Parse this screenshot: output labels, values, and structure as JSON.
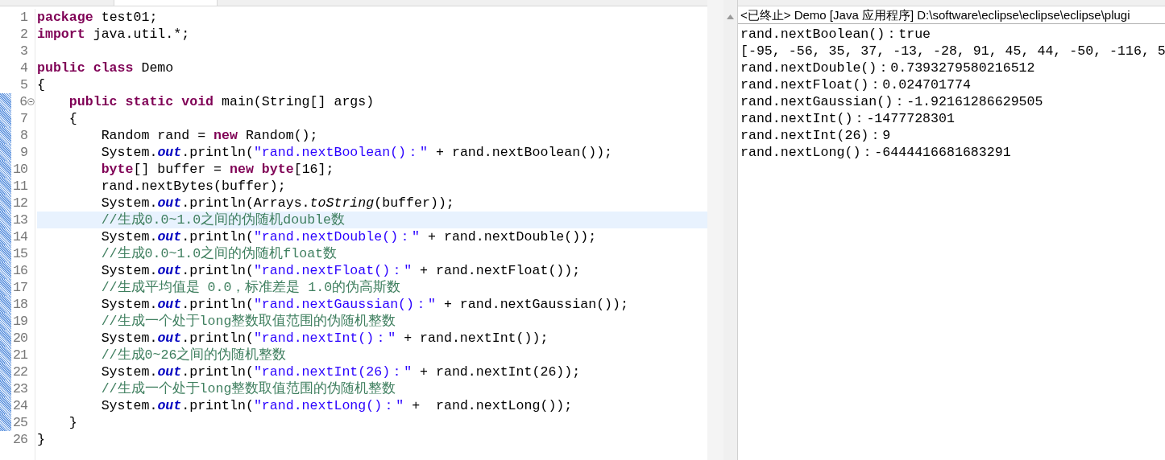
{
  "editor": {
    "lines": [
      {
        "number": "1",
        "changed": false,
        "current": false,
        "foldable": false,
        "tokens": [
          {
            "kind": "keyword",
            "text": "package"
          },
          {
            "kind": "plain",
            "text": " test01;"
          }
        ]
      },
      {
        "number": "2",
        "changed": false,
        "current": false,
        "foldable": false,
        "tokens": [
          {
            "kind": "keyword",
            "text": "import"
          },
          {
            "kind": "plain",
            "text": " java.util.*;"
          }
        ]
      },
      {
        "number": "3",
        "changed": false,
        "current": false,
        "foldable": false
      },
      {
        "number": "4",
        "changed": false,
        "current": false,
        "foldable": false,
        "tokens": [
          {
            "kind": "keyword",
            "text": "public class"
          },
          {
            "kind": "plain",
            "text": " Demo"
          }
        ]
      },
      {
        "number": "5",
        "changed": false,
        "current": false,
        "foldable": false,
        "tokens": [
          {
            "kind": "plain",
            "text": "{"
          }
        ]
      },
      {
        "number": "6",
        "changed": true,
        "current": false,
        "foldable": true,
        "tokens": [
          {
            "kind": "keyword",
            "text": "    public static void"
          },
          {
            "kind": "plain",
            "text": " main(String[] args)"
          }
        ]
      },
      {
        "number": "7",
        "changed": true,
        "current": false,
        "foldable": false,
        "tokens": [
          {
            "kind": "plain",
            "text": "    {"
          }
        ]
      },
      {
        "number": "8",
        "changed": true,
        "current": false,
        "foldable": false,
        "tokens": [
          {
            "kind": "plain",
            "text": "        Random rand = "
          },
          {
            "kind": "keyword",
            "text": "new"
          },
          {
            "kind": "plain",
            "text": " Random();"
          }
        ]
      },
      {
        "number": "9",
        "changed": true,
        "current": false,
        "foldable": false,
        "tokens": [
          {
            "kind": "plain",
            "text": "        System."
          },
          {
            "kind": "field",
            "text": "out"
          },
          {
            "kind": "plain",
            "text": ".println("
          },
          {
            "kind": "string",
            "text": "\"rand.nextBoolean()：\""
          },
          {
            "kind": "plain",
            "text": " + rand.nextBoolean());"
          }
        ]
      },
      {
        "number": "10",
        "changed": true,
        "current": false,
        "foldable": false,
        "tokens": [
          {
            "kind": "keyword",
            "text": "        byte"
          },
          {
            "kind": "plain",
            "text": "[] buffer = "
          },
          {
            "kind": "keyword",
            "text": "new byte"
          },
          {
            "kind": "plain",
            "text": "[16];"
          }
        ]
      },
      {
        "number": "11",
        "changed": true,
        "current": false,
        "foldable": false,
        "tokens": [
          {
            "kind": "plain",
            "text": "        rand.nextBytes(buffer);"
          }
        ]
      },
      {
        "number": "12",
        "changed": true,
        "current": false,
        "foldable": false,
        "tokens": [
          {
            "kind": "plain",
            "text": "        System."
          },
          {
            "kind": "field",
            "text": "out"
          },
          {
            "kind": "plain",
            "text": ".println(Arrays."
          },
          {
            "kind": "static",
            "text": "toString"
          },
          {
            "kind": "plain",
            "text": "(buffer));"
          }
        ]
      },
      {
        "number": "13",
        "changed": true,
        "current": true,
        "foldable": false,
        "tokens": [
          {
            "kind": "comment",
            "text": "        //生成0.0~1.0之间的伪随机double数"
          }
        ]
      },
      {
        "number": "14",
        "changed": true,
        "current": false,
        "foldable": false,
        "tokens": [
          {
            "kind": "plain",
            "text": "        System."
          },
          {
            "kind": "field",
            "text": "out"
          },
          {
            "kind": "plain",
            "text": ".println("
          },
          {
            "kind": "string",
            "text": "\"rand.nextDouble()：\""
          },
          {
            "kind": "plain",
            "text": " + rand.nextDouble());"
          }
        ]
      },
      {
        "number": "15",
        "changed": true,
        "current": false,
        "foldable": false,
        "tokens": [
          {
            "kind": "comment",
            "text": "        //生成0.0~1.0之间的伪随机float数"
          }
        ]
      },
      {
        "number": "16",
        "changed": true,
        "current": false,
        "foldable": false,
        "tokens": [
          {
            "kind": "plain",
            "text": "        System."
          },
          {
            "kind": "field",
            "text": "out"
          },
          {
            "kind": "plain",
            "text": ".println("
          },
          {
            "kind": "string",
            "text": "\"rand.nextFloat()：\""
          },
          {
            "kind": "plain",
            "text": " + rand.nextFloat());"
          }
        ]
      },
      {
        "number": "17",
        "changed": true,
        "current": false,
        "foldable": false,
        "tokens": [
          {
            "kind": "comment",
            "text": "        //生成平均值是 0.0，标准差是 1.0的伪高斯数"
          }
        ]
      },
      {
        "number": "18",
        "changed": true,
        "current": false,
        "foldable": false,
        "tokens": [
          {
            "kind": "plain",
            "text": "        System."
          },
          {
            "kind": "field",
            "text": "out"
          },
          {
            "kind": "plain",
            "text": ".println("
          },
          {
            "kind": "string",
            "text": "\"rand.nextGaussian()：\""
          },
          {
            "kind": "plain",
            "text": " + rand.nextGaussian());"
          }
        ]
      },
      {
        "number": "19",
        "changed": true,
        "current": false,
        "foldable": false,
        "tokens": [
          {
            "kind": "comment",
            "text": "        //生成一个处于long整数取值范围的伪随机整数"
          }
        ]
      },
      {
        "number": "20",
        "changed": true,
        "current": false,
        "foldable": false,
        "tokens": [
          {
            "kind": "plain",
            "text": "        System."
          },
          {
            "kind": "field",
            "text": "out"
          },
          {
            "kind": "plain",
            "text": ".println("
          },
          {
            "kind": "string",
            "text": "\"rand.nextInt()：\""
          },
          {
            "kind": "plain",
            "text": " + rand.nextInt());"
          }
        ]
      },
      {
        "number": "21",
        "changed": true,
        "current": false,
        "foldable": false,
        "tokens": [
          {
            "kind": "comment",
            "text": "        //生成0~26之间的伪随机整数"
          }
        ]
      },
      {
        "number": "22",
        "changed": true,
        "current": false,
        "foldable": false,
        "tokens": [
          {
            "kind": "plain",
            "text": "        System."
          },
          {
            "kind": "field",
            "text": "out"
          },
          {
            "kind": "plain",
            "text": ".println("
          },
          {
            "kind": "string",
            "text": "\"rand.nextInt(26)：\""
          },
          {
            "kind": "plain",
            "text": " + rand.nextInt(26));"
          }
        ]
      },
      {
        "number": "23",
        "changed": true,
        "current": false,
        "foldable": false,
        "tokens": [
          {
            "kind": "comment",
            "text": "        //生成一个处于long整数取值范围的伪随机整数"
          }
        ]
      },
      {
        "number": "24",
        "changed": true,
        "current": false,
        "foldable": false,
        "tokens": [
          {
            "kind": "plain",
            "text": "        System."
          },
          {
            "kind": "field",
            "text": "out"
          },
          {
            "kind": "plain",
            "text": ".println("
          },
          {
            "kind": "string",
            "text": "\"rand.nextLong()：\""
          },
          {
            "kind": "plain",
            "text": " +  rand.nextLong());"
          }
        ]
      },
      {
        "number": "25",
        "changed": true,
        "current": false,
        "foldable": false,
        "tokens": [
          {
            "kind": "plain",
            "text": "    }"
          }
        ]
      },
      {
        "number": "26",
        "changed": false,
        "current": false,
        "foldable": false,
        "tokens": [
          {
            "kind": "plain",
            "text": "}"
          }
        ]
      }
    ]
  },
  "console": {
    "header": "<已终止> Demo [Java 应用程序] D:\\software\\eclipse\\eclipse\\eclipse\\plugi",
    "output": [
      "rand.nextBoolean()：true",
      "[-95, -56, 35, 37, -13, -28, 91, 45, 44, -50, -116, 5",
      "rand.nextDouble()：0.7393279580216512",
      "rand.nextFloat()：0.024701774",
      "rand.nextGaussian()：-1.92161286629505",
      "rand.nextInt()：-1477728301",
      "rand.nextInt(26)：9",
      "rand.nextLong()：-6444416681683291"
    ]
  }
}
